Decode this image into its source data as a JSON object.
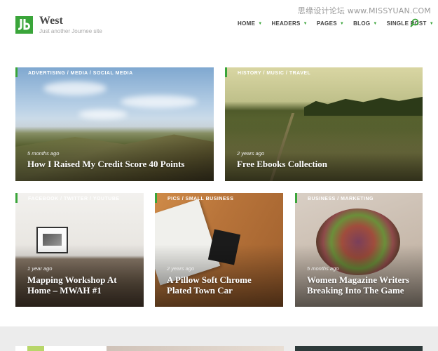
{
  "watermark": "思缘设计论坛 www.MISSYUAN.COM",
  "header": {
    "title": "West",
    "tagline": "Just another Journee site",
    "logo_icon": "jb-logo-icon",
    "accent_color": "#3aa53a"
  },
  "nav": {
    "items": [
      {
        "label": "HOME"
      },
      {
        "label": "HEADERS"
      },
      {
        "label": "PAGES"
      },
      {
        "label": "BLOG"
      },
      {
        "label": "SINGLE POST"
      }
    ],
    "search_icon": "search-icon"
  },
  "posts": [
    {
      "categories": "ADVERTISING / MEDIA / SOCIAL MEDIA",
      "date": "5 months ago",
      "title": "How I Raised My Credit Score 40 Points"
    },
    {
      "categories": "HISTORY / MUSIC / TRAVEL",
      "date": "2 years ago",
      "title": "Free Ebooks Collection"
    },
    {
      "categories": "FACEBOOK / TWITTER / YOUTUBE",
      "date": "1 year ago",
      "title": "Mapping Workshop At Home – MWAH #1"
    },
    {
      "categories": "PICS / SMALL BUSINESS",
      "date": "2 years ago",
      "title": "A Pillow Soft Chrome Plated Town Car"
    },
    {
      "categories": "BUSINESS / MARKETING",
      "date": "5 months ago",
      "title": "Women Magazine Writers Breaking Into The Game"
    }
  ]
}
